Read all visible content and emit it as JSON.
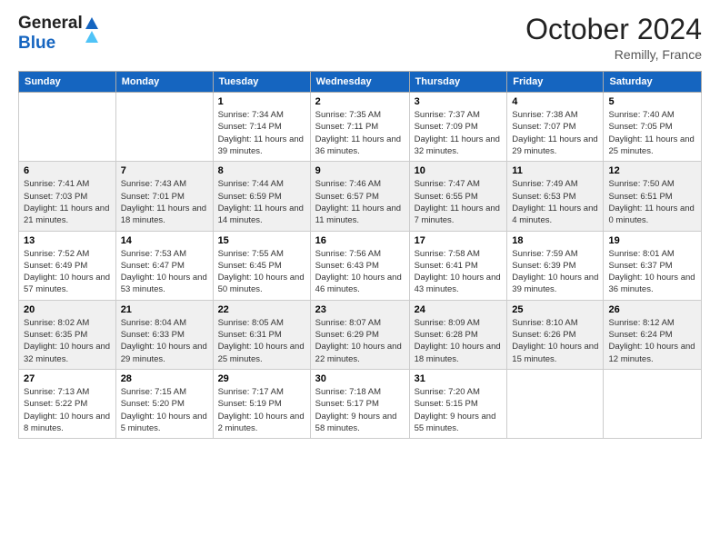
{
  "header": {
    "logo_general": "General",
    "logo_blue": "Blue",
    "month_title": "October 2024",
    "location": "Remilly, France"
  },
  "days_of_week": [
    "Sunday",
    "Monday",
    "Tuesday",
    "Wednesday",
    "Thursday",
    "Friday",
    "Saturday"
  ],
  "weeks": [
    [
      {
        "day": "",
        "info": ""
      },
      {
        "day": "",
        "info": ""
      },
      {
        "day": "1",
        "info": "Sunrise: 7:34 AM\nSunset: 7:14 PM\nDaylight: 11 hours and 39 minutes."
      },
      {
        "day": "2",
        "info": "Sunrise: 7:35 AM\nSunset: 7:11 PM\nDaylight: 11 hours and 36 minutes."
      },
      {
        "day": "3",
        "info": "Sunrise: 7:37 AM\nSunset: 7:09 PM\nDaylight: 11 hours and 32 minutes."
      },
      {
        "day": "4",
        "info": "Sunrise: 7:38 AM\nSunset: 7:07 PM\nDaylight: 11 hours and 29 minutes."
      },
      {
        "day": "5",
        "info": "Sunrise: 7:40 AM\nSunset: 7:05 PM\nDaylight: 11 hours and 25 minutes."
      }
    ],
    [
      {
        "day": "6",
        "info": "Sunrise: 7:41 AM\nSunset: 7:03 PM\nDaylight: 11 hours and 21 minutes."
      },
      {
        "day": "7",
        "info": "Sunrise: 7:43 AM\nSunset: 7:01 PM\nDaylight: 11 hours and 18 minutes."
      },
      {
        "day": "8",
        "info": "Sunrise: 7:44 AM\nSunset: 6:59 PM\nDaylight: 11 hours and 14 minutes."
      },
      {
        "day": "9",
        "info": "Sunrise: 7:46 AM\nSunset: 6:57 PM\nDaylight: 11 hours and 11 minutes."
      },
      {
        "day": "10",
        "info": "Sunrise: 7:47 AM\nSunset: 6:55 PM\nDaylight: 11 hours and 7 minutes."
      },
      {
        "day": "11",
        "info": "Sunrise: 7:49 AM\nSunset: 6:53 PM\nDaylight: 11 hours and 4 minutes."
      },
      {
        "day": "12",
        "info": "Sunrise: 7:50 AM\nSunset: 6:51 PM\nDaylight: 11 hours and 0 minutes."
      }
    ],
    [
      {
        "day": "13",
        "info": "Sunrise: 7:52 AM\nSunset: 6:49 PM\nDaylight: 10 hours and 57 minutes."
      },
      {
        "day": "14",
        "info": "Sunrise: 7:53 AM\nSunset: 6:47 PM\nDaylight: 10 hours and 53 minutes."
      },
      {
        "day": "15",
        "info": "Sunrise: 7:55 AM\nSunset: 6:45 PM\nDaylight: 10 hours and 50 minutes."
      },
      {
        "day": "16",
        "info": "Sunrise: 7:56 AM\nSunset: 6:43 PM\nDaylight: 10 hours and 46 minutes."
      },
      {
        "day": "17",
        "info": "Sunrise: 7:58 AM\nSunset: 6:41 PM\nDaylight: 10 hours and 43 minutes."
      },
      {
        "day": "18",
        "info": "Sunrise: 7:59 AM\nSunset: 6:39 PM\nDaylight: 10 hours and 39 minutes."
      },
      {
        "day": "19",
        "info": "Sunrise: 8:01 AM\nSunset: 6:37 PM\nDaylight: 10 hours and 36 minutes."
      }
    ],
    [
      {
        "day": "20",
        "info": "Sunrise: 8:02 AM\nSunset: 6:35 PM\nDaylight: 10 hours and 32 minutes."
      },
      {
        "day": "21",
        "info": "Sunrise: 8:04 AM\nSunset: 6:33 PM\nDaylight: 10 hours and 29 minutes."
      },
      {
        "day": "22",
        "info": "Sunrise: 8:05 AM\nSunset: 6:31 PM\nDaylight: 10 hours and 25 minutes."
      },
      {
        "day": "23",
        "info": "Sunrise: 8:07 AM\nSunset: 6:29 PM\nDaylight: 10 hours and 22 minutes."
      },
      {
        "day": "24",
        "info": "Sunrise: 8:09 AM\nSunset: 6:28 PM\nDaylight: 10 hours and 18 minutes."
      },
      {
        "day": "25",
        "info": "Sunrise: 8:10 AM\nSunset: 6:26 PM\nDaylight: 10 hours and 15 minutes."
      },
      {
        "day": "26",
        "info": "Sunrise: 8:12 AM\nSunset: 6:24 PM\nDaylight: 10 hours and 12 minutes."
      }
    ],
    [
      {
        "day": "27",
        "info": "Sunrise: 7:13 AM\nSunset: 5:22 PM\nDaylight: 10 hours and 8 minutes."
      },
      {
        "day": "28",
        "info": "Sunrise: 7:15 AM\nSunset: 5:20 PM\nDaylight: 10 hours and 5 minutes."
      },
      {
        "day": "29",
        "info": "Sunrise: 7:17 AM\nSunset: 5:19 PM\nDaylight: 10 hours and 2 minutes."
      },
      {
        "day": "30",
        "info": "Sunrise: 7:18 AM\nSunset: 5:17 PM\nDaylight: 9 hours and 58 minutes."
      },
      {
        "day": "31",
        "info": "Sunrise: 7:20 AM\nSunset: 5:15 PM\nDaylight: 9 hours and 55 minutes."
      },
      {
        "day": "",
        "info": ""
      },
      {
        "day": "",
        "info": ""
      }
    ]
  ]
}
